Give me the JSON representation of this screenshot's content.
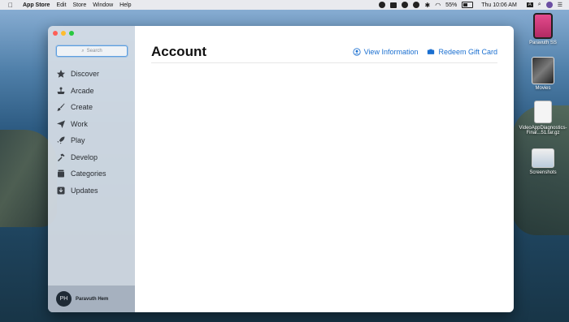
{
  "menubar": {
    "app_name": "App Store",
    "menus": [
      "Edit",
      "Store",
      "Window",
      "Help"
    ],
    "battery": "55%",
    "clock": "Thu 10:06 AM"
  },
  "sidebar": {
    "search_placeholder": "Search",
    "items": [
      {
        "label": "Discover",
        "icon": "star-icon"
      },
      {
        "label": "Arcade",
        "icon": "arcade-icon"
      },
      {
        "label": "Create",
        "icon": "brush-icon"
      },
      {
        "label": "Work",
        "icon": "paperplane-icon"
      },
      {
        "label": "Play",
        "icon": "rocket-icon"
      },
      {
        "label": "Develop",
        "icon": "hammer-icon"
      },
      {
        "label": "Categories",
        "icon": "stack-icon"
      },
      {
        "label": "Updates",
        "icon": "download-icon"
      }
    ],
    "account": {
      "initials": "PH",
      "name": "Paravuth Hem"
    }
  },
  "main": {
    "title": "Account",
    "view_info": "View Information",
    "redeem": "Redeem Gift Card"
  },
  "desktop": {
    "icons": [
      {
        "label": "Paravuth SS"
      },
      {
        "label": "Movies"
      },
      {
        "label": "VideoAppDiagnostics-Final...51.tar.gz"
      },
      {
        "label": "Screenshots"
      }
    ]
  },
  "colors": {
    "accent": "#1a6fd0",
    "close": "#fe5f57",
    "minimize": "#febc2e",
    "zoom": "#28c840"
  }
}
